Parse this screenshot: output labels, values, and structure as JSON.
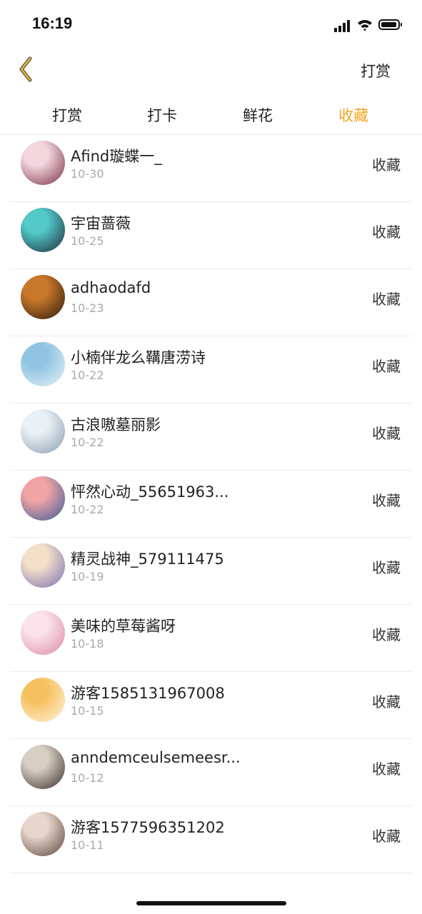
{
  "status": {
    "time": "16:19"
  },
  "nav": {
    "action_label": "打赏"
  },
  "tabs": [
    {
      "label": "打赏",
      "active": false
    },
    {
      "label": "打卡",
      "active": false
    },
    {
      "label": "鲜花",
      "active": false
    },
    {
      "label": "收藏",
      "active": true
    }
  ],
  "colors": {
    "accent": "#f0a720",
    "back_icon": "#e2b43a",
    "divider": "#ececec"
  },
  "items": [
    {
      "name": "Afind璇蝶一_",
      "date": "10-30",
      "action": "收藏",
      "avatar_colors": [
        "#f3d6de",
        "#7a3146"
      ]
    },
    {
      "name": "宇宙蔷薇",
      "date": "10-25",
      "action": "收藏",
      "avatar_colors": [
        "#53c9c8",
        "#1c2b3a"
      ]
    },
    {
      "name": "adhaodafd",
      "date": "10-23",
      "action": "收藏",
      "avatar_colors": [
        "#c9772a",
        "#2a1a0f"
      ]
    },
    {
      "name": "小楠伴龙么鞲唐涝诗",
      "date": "10-22",
      "action": "收藏",
      "avatar_colors": [
        "#8fc4e2",
        "#e8f2f7"
      ]
    },
    {
      "name": "古浪嗷墓丽影",
      "date": "10-22",
      "action": "收藏",
      "avatar_colors": [
        "#e9f1f6",
        "#8a9cae"
      ]
    },
    {
      "name": "怦然心动_55651963...",
      "date": "10-22",
      "action": "收藏",
      "avatar_colors": [
        "#f0a4a4",
        "#3b5a9c"
      ]
    },
    {
      "name": "精灵战神_579111475",
      "date": "10-19",
      "action": "收藏",
      "avatar_colors": [
        "#f4e0c8",
        "#7a6fb3"
      ]
    },
    {
      "name": "美味的草莓酱呀",
      "date": "10-18",
      "action": "收藏",
      "avatar_colors": [
        "#fbe3ea",
        "#d98aa8"
      ]
    },
    {
      "name": "游客1585131967008",
      "date": "10-15",
      "action": "收藏",
      "avatar_colors": [
        "#f6c260",
        "#fff4e0"
      ]
    },
    {
      "name": "anndemceulsemeesr...",
      "date": "10-12",
      "action": "收藏",
      "avatar_colors": [
        "#d8cfc4",
        "#3a2f2a"
      ]
    },
    {
      "name": "游客1577596351202",
      "date": "10-11",
      "action": "收藏",
      "avatar_colors": [
        "#e7d6cc",
        "#5a4438"
      ]
    }
  ]
}
